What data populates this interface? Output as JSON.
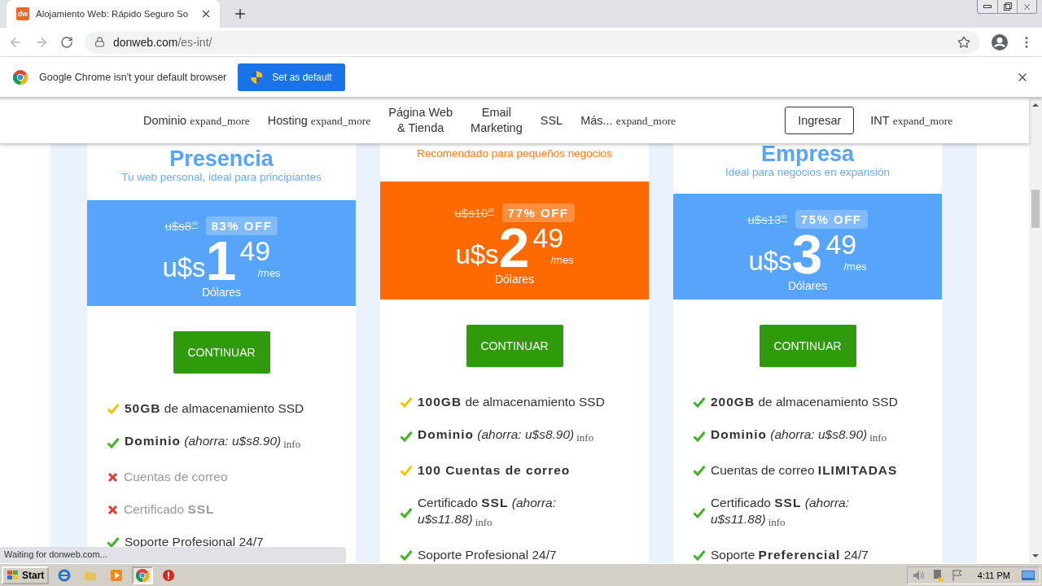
{
  "browser": {
    "tab": {
      "favicon": "dw",
      "title": "Alojamiento Web: Rápido Seguro So"
    },
    "address": {
      "domain": "donweb.com",
      "path": "/es-int/"
    }
  },
  "infobar": {
    "message": "Google Chrome isn't your default browser",
    "button": "Set as default"
  },
  "nav": {
    "items": [
      {
        "lines": [
          "Dominio"
        ],
        "dropdown": "expand_more"
      },
      {
        "lines": [
          "Hosting"
        ],
        "dropdown": "expand_more"
      },
      {
        "lines": [
          "Página Web",
          "& Tienda"
        ]
      },
      {
        "lines": [
          "Email",
          "Marketing"
        ]
      },
      {
        "lines": [
          "SSL"
        ]
      },
      {
        "lines": [
          "Más..."
        ],
        "dropdown": "expand_more"
      }
    ],
    "login": "Ingresar",
    "region": {
      "label": "INT",
      "dropdown": "expand_more"
    }
  },
  "plans": [
    {
      "title": "Presencia",
      "subtitle": "Tu web personal, ideal para principiantes",
      "color": "#57a4fc",
      "old_price": "u$s8",
      "old_cents": "99",
      "discount": "83% OFF",
      "currency": "u$s",
      "price": "1",
      "cents": "49",
      "period": "/mes",
      "unit": "Dólares",
      "button": "CONTINUAR",
      "features": [
        {
          "kind": "partial",
          "disabled": false,
          "text": "**50GB** de almacenamiento SSD"
        },
        {
          "kind": "check",
          "disabled": false,
          "text": "**Dominio** *(ahorra: u$s8.90)*",
          "info": "info"
        },
        {
          "kind": "cross",
          "disabled": true,
          "text": "Cuentas de correo"
        },
        {
          "kind": "cross",
          "disabled": true,
          "text": "Certificado **SSL**"
        },
        {
          "kind": "check",
          "disabled": false,
          "text": "Soporte Profesional 24/7"
        }
      ]
    },
    {
      "subtitle": "Recomendado para pequeños negocios",
      "color": "#ff6a00",
      "old_price": "u$s10",
      "old_cents": "99",
      "discount": "77% OFF",
      "currency": "u$s",
      "price": "2",
      "cents": "49",
      "period": "/mes",
      "unit": "Dólares",
      "button": "CONTINUAR",
      "features": [
        {
          "kind": "partial",
          "disabled": false,
          "text": "**100GB** de almacenamiento SSD"
        },
        {
          "kind": "check",
          "disabled": false,
          "text": "**Dominio** *(ahorra: u$s8.90)*",
          "info": "info"
        },
        {
          "kind": "partial",
          "disabled": false,
          "text": "**100 Cuentas de correo**"
        },
        {
          "kind": "check",
          "disabled": false,
          "text": "Certificado **SSL** *(ahorra: u$s11.88)*",
          "info": "info"
        },
        {
          "kind": "check",
          "disabled": false,
          "text": "Soporte Profesional 24/7"
        }
      ]
    },
    {
      "title": "Empresa",
      "subtitle": "Ideal para negocios en expansión",
      "color": "#57a4fc",
      "old_price": "u$s13",
      "old_cents": "99",
      "discount": "75% OFF",
      "currency": "u$s",
      "price": "3",
      "cents": "49",
      "period": "/mes",
      "unit": "Dólares",
      "button": "CONTINUAR",
      "features": [
        {
          "kind": "check",
          "disabled": false,
          "text": "**200GB** de almacenamiento SSD"
        },
        {
          "kind": "check",
          "disabled": false,
          "text": "**Dominio** *(ahorra: u$s8.90)*",
          "info": "info"
        },
        {
          "kind": "check",
          "disabled": false,
          "text": "Cuentas de correo **ILIMITADAS**"
        },
        {
          "kind": "check",
          "disabled": false,
          "text": "Certificado **SSL** *(ahorra: u$s11.88)*",
          "info": "info"
        },
        {
          "kind": "check",
          "disabled": false,
          "text": "Soporte **Preferencial** 24/7"
        }
      ]
    }
  ],
  "status": "Waiting for donweb.com...",
  "taskbar": {
    "start": "Start",
    "time": "4:11 PM"
  }
}
